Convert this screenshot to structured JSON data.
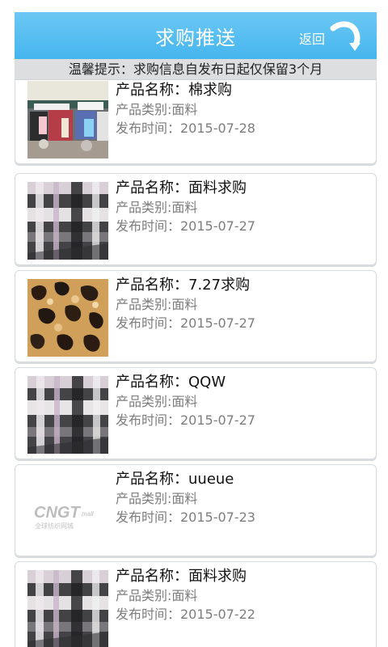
{
  "header": {
    "title": "求购推送",
    "back_label": "返回",
    "back_icon": "curved-arrow-down-icon"
  },
  "notice": "温馨提示：求购信息自发布日起仅保留3个月",
  "items": [
    {
      "name": "产品名称：棉求购",
      "category": "产品类别:面料",
      "date": "发布时间：2015-07-28",
      "thumb_type": "store-photo"
    },
    {
      "name": "产品名称：面料求购",
      "category": "产品类别:面料",
      "date": "发布时间：2015-07-27",
      "thumb_type": "plaid-fabric"
    },
    {
      "name": "产品名称：7.27求购",
      "category": "产品类别:面料",
      "date": "发布时间：2015-07-27",
      "thumb_type": "leopard-fabric"
    },
    {
      "name": "产品名称：QQW",
      "category": "产品类别:面料",
      "date": "发布时间：2015-07-27",
      "thumb_type": "plaid-fabric"
    },
    {
      "name": "产品名称：uueue",
      "category": "产品类别:面料",
      "date": "发布时间：2015-07-23",
      "thumb_type": "cngt-logo",
      "logo_text": "CNGT",
      "logo_small": "mall",
      "logo_caption": "全球纺织网城"
    },
    {
      "name": "产品名称：面料求购",
      "category": "产品类别:面料",
      "date": "发布时间：2015-07-22",
      "thumb_type": "plaid-fabric"
    }
  ]
}
